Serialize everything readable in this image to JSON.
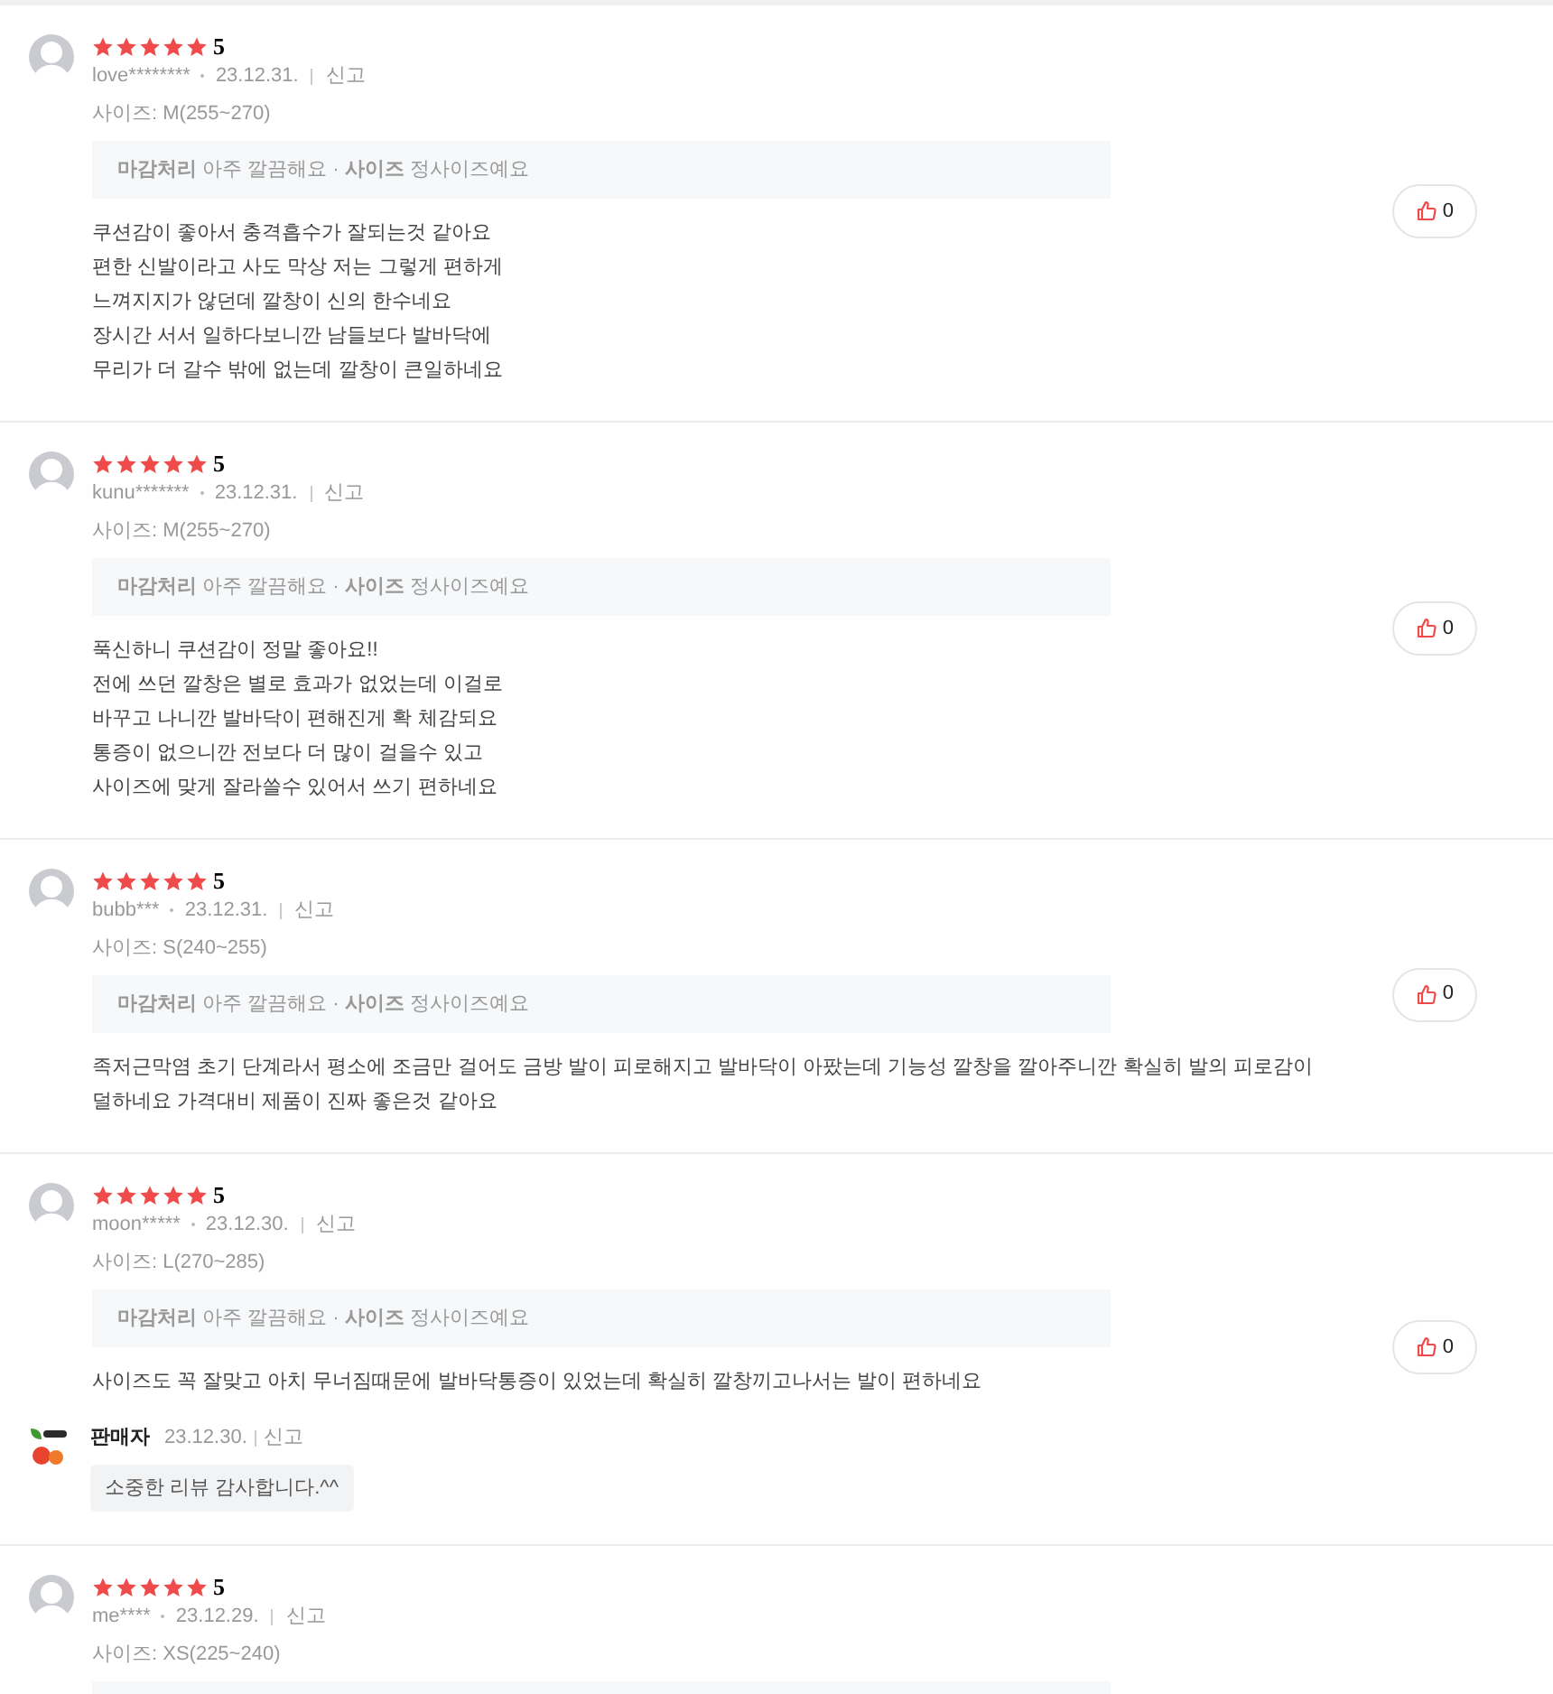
{
  "reviews": [
    {
      "stars": 5,
      "score": "5",
      "user": "love********",
      "date": "23.12.31.",
      "report": "신고",
      "size": "사이즈: M(255~270)",
      "tags": "**마감처리** 아주 깔끔해요 · **사이즈** 정사이즈예요",
      "body": [
        "쿠션감이 좋아서 충격흡수가 잘되는것 같아요",
        "편한 신발이라고 사도 막상 저는 그렇게 편하게",
        "느껴지지가 않던데 깔창이 신의 한수네요",
        "장시간 서서 일하다보니깐 남들보다 발바닥에",
        "무리가 더 갈수 밖에 없는데 깔창이 큰일하네요"
      ],
      "likes": "0"
    },
    {
      "stars": 5,
      "score": "5",
      "user": "kunu*******",
      "date": "23.12.31.",
      "report": "신고",
      "size": "사이즈: M(255~270)",
      "tags": "**마감처리** 아주 깔끔해요 · **사이즈** 정사이즈예요",
      "body": [
        "푹신하니 쿠션감이 정말 좋아요!!",
        "전에 쓰던 깔창은 별로 효과가 없었는데 이걸로",
        "바꾸고 나니깐 발바닥이 편해진게 확 체감되요",
        "통증이 없으니깐 전보다 더 많이 걸을수 있고",
        "사이즈에 맞게 잘라쓸수 있어서 쓰기 편하네요"
      ],
      "likes": "0"
    },
    {
      "stars": 5,
      "score": "5",
      "user": "bubb***",
      "date": "23.12.31.",
      "report": "신고",
      "size": "사이즈: S(240~255)",
      "tags": "**마감처리** 아주 깔끔해요 · **사이즈** 정사이즈예요",
      "body": [
        "족저근막염 초기 단계라서 평소에 조금만 걸어도 금방 발이 피로해지고 발바닥이 아팠는데 기능성 깔창을 깔아주니깐 확실히 발의 피로감이 덜하네요 가격대비 제품이 진짜 좋은것 같아요"
      ],
      "likes": "0"
    },
    {
      "stars": 5,
      "score": "5",
      "user": "moon*****",
      "date": "23.12.30.",
      "report": "신고",
      "size": "사이즈: L(270~285)",
      "tags": "**마감처리** 아주 깔끔해요 · **사이즈** 정사이즈예요",
      "body": [
        "사이즈도 꼭 잘맞고 아치 무너짐때문에 발바닥통증이 있었는데 확실히 깔창끼고나서는 발이 편하네요"
      ],
      "likes": "0",
      "reply": {
        "author": "판매자",
        "date": "23.12.30.",
        "report": "신고",
        "text": "소중한 리뷰 감사합니다.^^"
      }
    },
    {
      "stars": 5,
      "score": "5",
      "user": "me****",
      "date": "23.12.29.",
      "report": "신고",
      "size": "사이즈: XS(225~240)"
    }
  ]
}
